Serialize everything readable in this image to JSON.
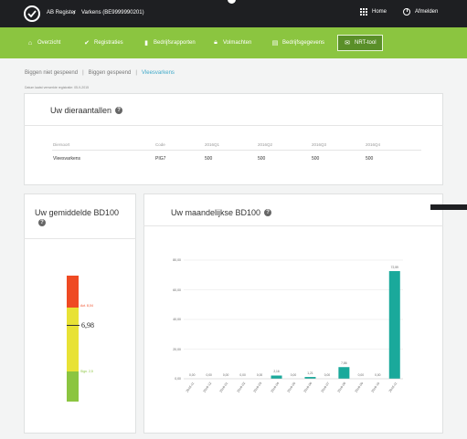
{
  "topbar": {
    "app_title": "AB Register",
    "context": "Varkens (BE9999990201)",
    "home_label": "Home",
    "logout_label": "Afmelden"
  },
  "nav": [
    {
      "label": "Overzicht",
      "icon": "home-icon"
    },
    {
      "label": "Registraties",
      "icon": "check-circle-icon"
    },
    {
      "label": "Bedrijfsrapporten",
      "icon": "bar-chart-icon"
    },
    {
      "label": "Volmachten",
      "icon": "lock-icon"
    },
    {
      "label": "Bedrijfsgegevens",
      "icon": "document-icon"
    },
    {
      "label": "NRT-tool",
      "icon": "envelope-icon",
      "active": true
    }
  ],
  "breadcrumb": [
    "Biggen niet gespeend",
    "Biggen gespeend",
    "Vleesvarkens"
  ],
  "note": "Datum laatst verwerkte registratie: 05-9-2015",
  "dieraantallen": {
    "title": "Uw dieraantallen",
    "headers": [
      "Diersoort",
      "Code",
      "2016Q1",
      "2016Q2",
      "2016Q3",
      "2016Q4"
    ],
    "row": [
      "Vleesvarkens",
      "PIG7",
      "500",
      "500",
      "500",
      "500"
    ]
  },
  "gemiddelde": {
    "title": "Uw gemiddelde BD100",
    "value": "6,98",
    "red_label": "Act. 8,04",
    "green_label": "Sign. 2,5",
    "colors": {
      "red": "#ef4a23",
      "yellow": "#e8e235",
      "green": "#8bc540"
    }
  },
  "maandelijkse": {
    "title": "Uw maandelijkse BD100"
  },
  "chart_data": {
    "type": "bar",
    "categories": [
      "2016-11",
      "2016-12",
      "2016-01",
      "2016-02",
      "2016-03",
      "2016-04",
      "2016-05",
      "2016-06",
      "2016-07",
      "2016-08",
      "2016-09",
      "2016-10",
      "2016-11"
    ],
    "values": [
      0.0,
      0.0,
      0.0,
      0.0,
      0.0,
      2.16,
      0.0,
      1.21,
      0.0,
      7.86,
      0.0,
      0.0,
      72.59
    ],
    "value_labels": [
      "0,00",
      "0,00",
      "0,00",
      "0,00",
      "0,00",
      "2,16",
      "0,00",
      "1,21",
      "0,00",
      "7,86",
      "0,00",
      "0,00",
      "72,59"
    ],
    "y_ticks": [
      "0,00",
      "20,00",
      "40,00",
      "60,00",
      "80,00"
    ],
    "ylim": [
      0,
      80
    ],
    "color": "#1aa99b",
    "grid": true
  }
}
